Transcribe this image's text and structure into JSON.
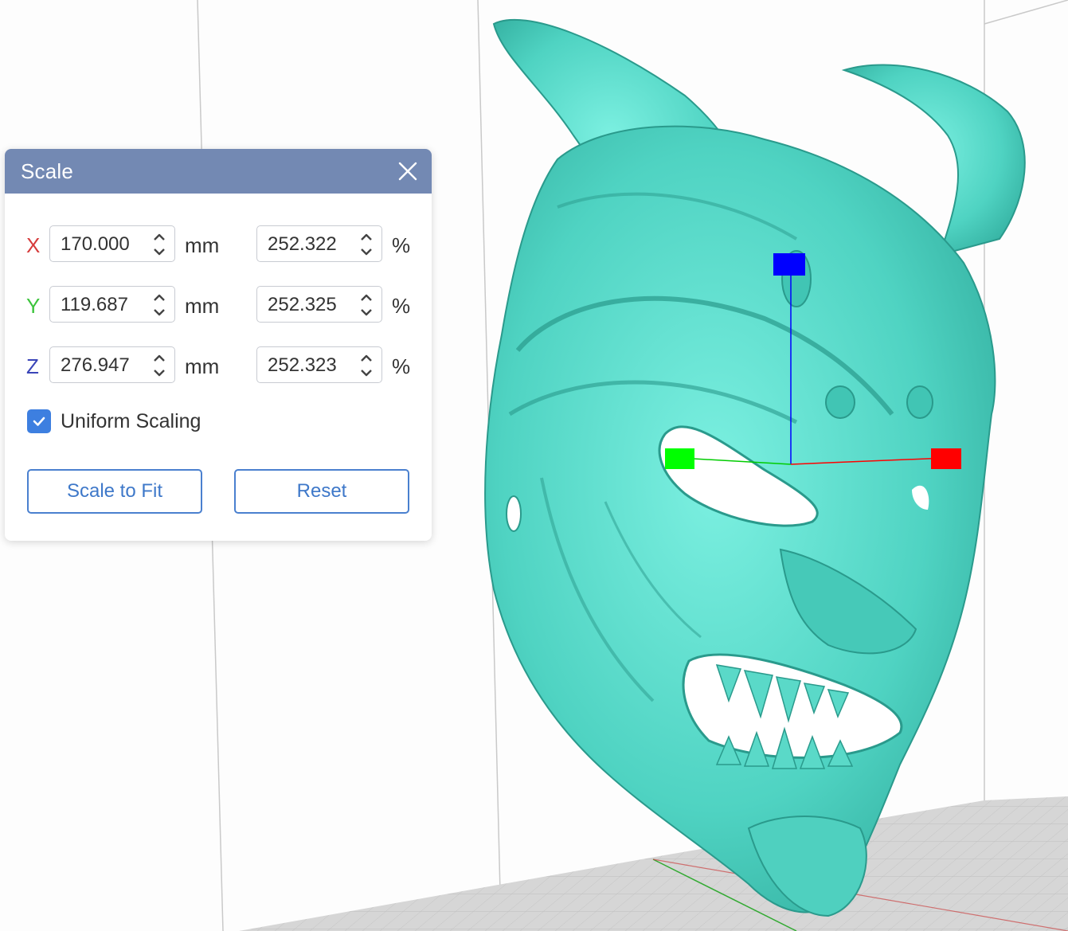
{
  "dialog": {
    "title": "Scale",
    "close_icon": "close-icon",
    "rows": [
      {
        "axis": "X",
        "axis_color": "#d63b3b",
        "mm": "170.000",
        "mm_unit": "mm",
        "percent": "252.322",
        "percent_unit": "%"
      },
      {
        "axis": "Y",
        "axis_color": "#3cc43c",
        "mm": "119.687",
        "mm_unit": "mm",
        "percent": "252.325",
        "percent_unit": "%"
      },
      {
        "axis": "Z",
        "axis_color": "#3a45b8",
        "mm": "276.947",
        "mm_unit": "mm",
        "percent": "252.323",
        "percent_unit": "%"
      }
    ],
    "uniform_scaling": {
      "label": "Uniform Scaling",
      "checked": true
    },
    "scale_to_fit_label": "Scale to Fit",
    "reset_label": "Reset"
  },
  "viewport": {
    "model": "horned-demon-mask",
    "model_color": "#5ee0cf",
    "gizmo": {
      "x_color": "#ff0000",
      "y_color": "#00ff00",
      "z_color": "#0000ff"
    },
    "bed_color": "#d9d9d9"
  },
  "colors": {
    "accent": "#3d7fe0",
    "header": "#7389b3"
  }
}
